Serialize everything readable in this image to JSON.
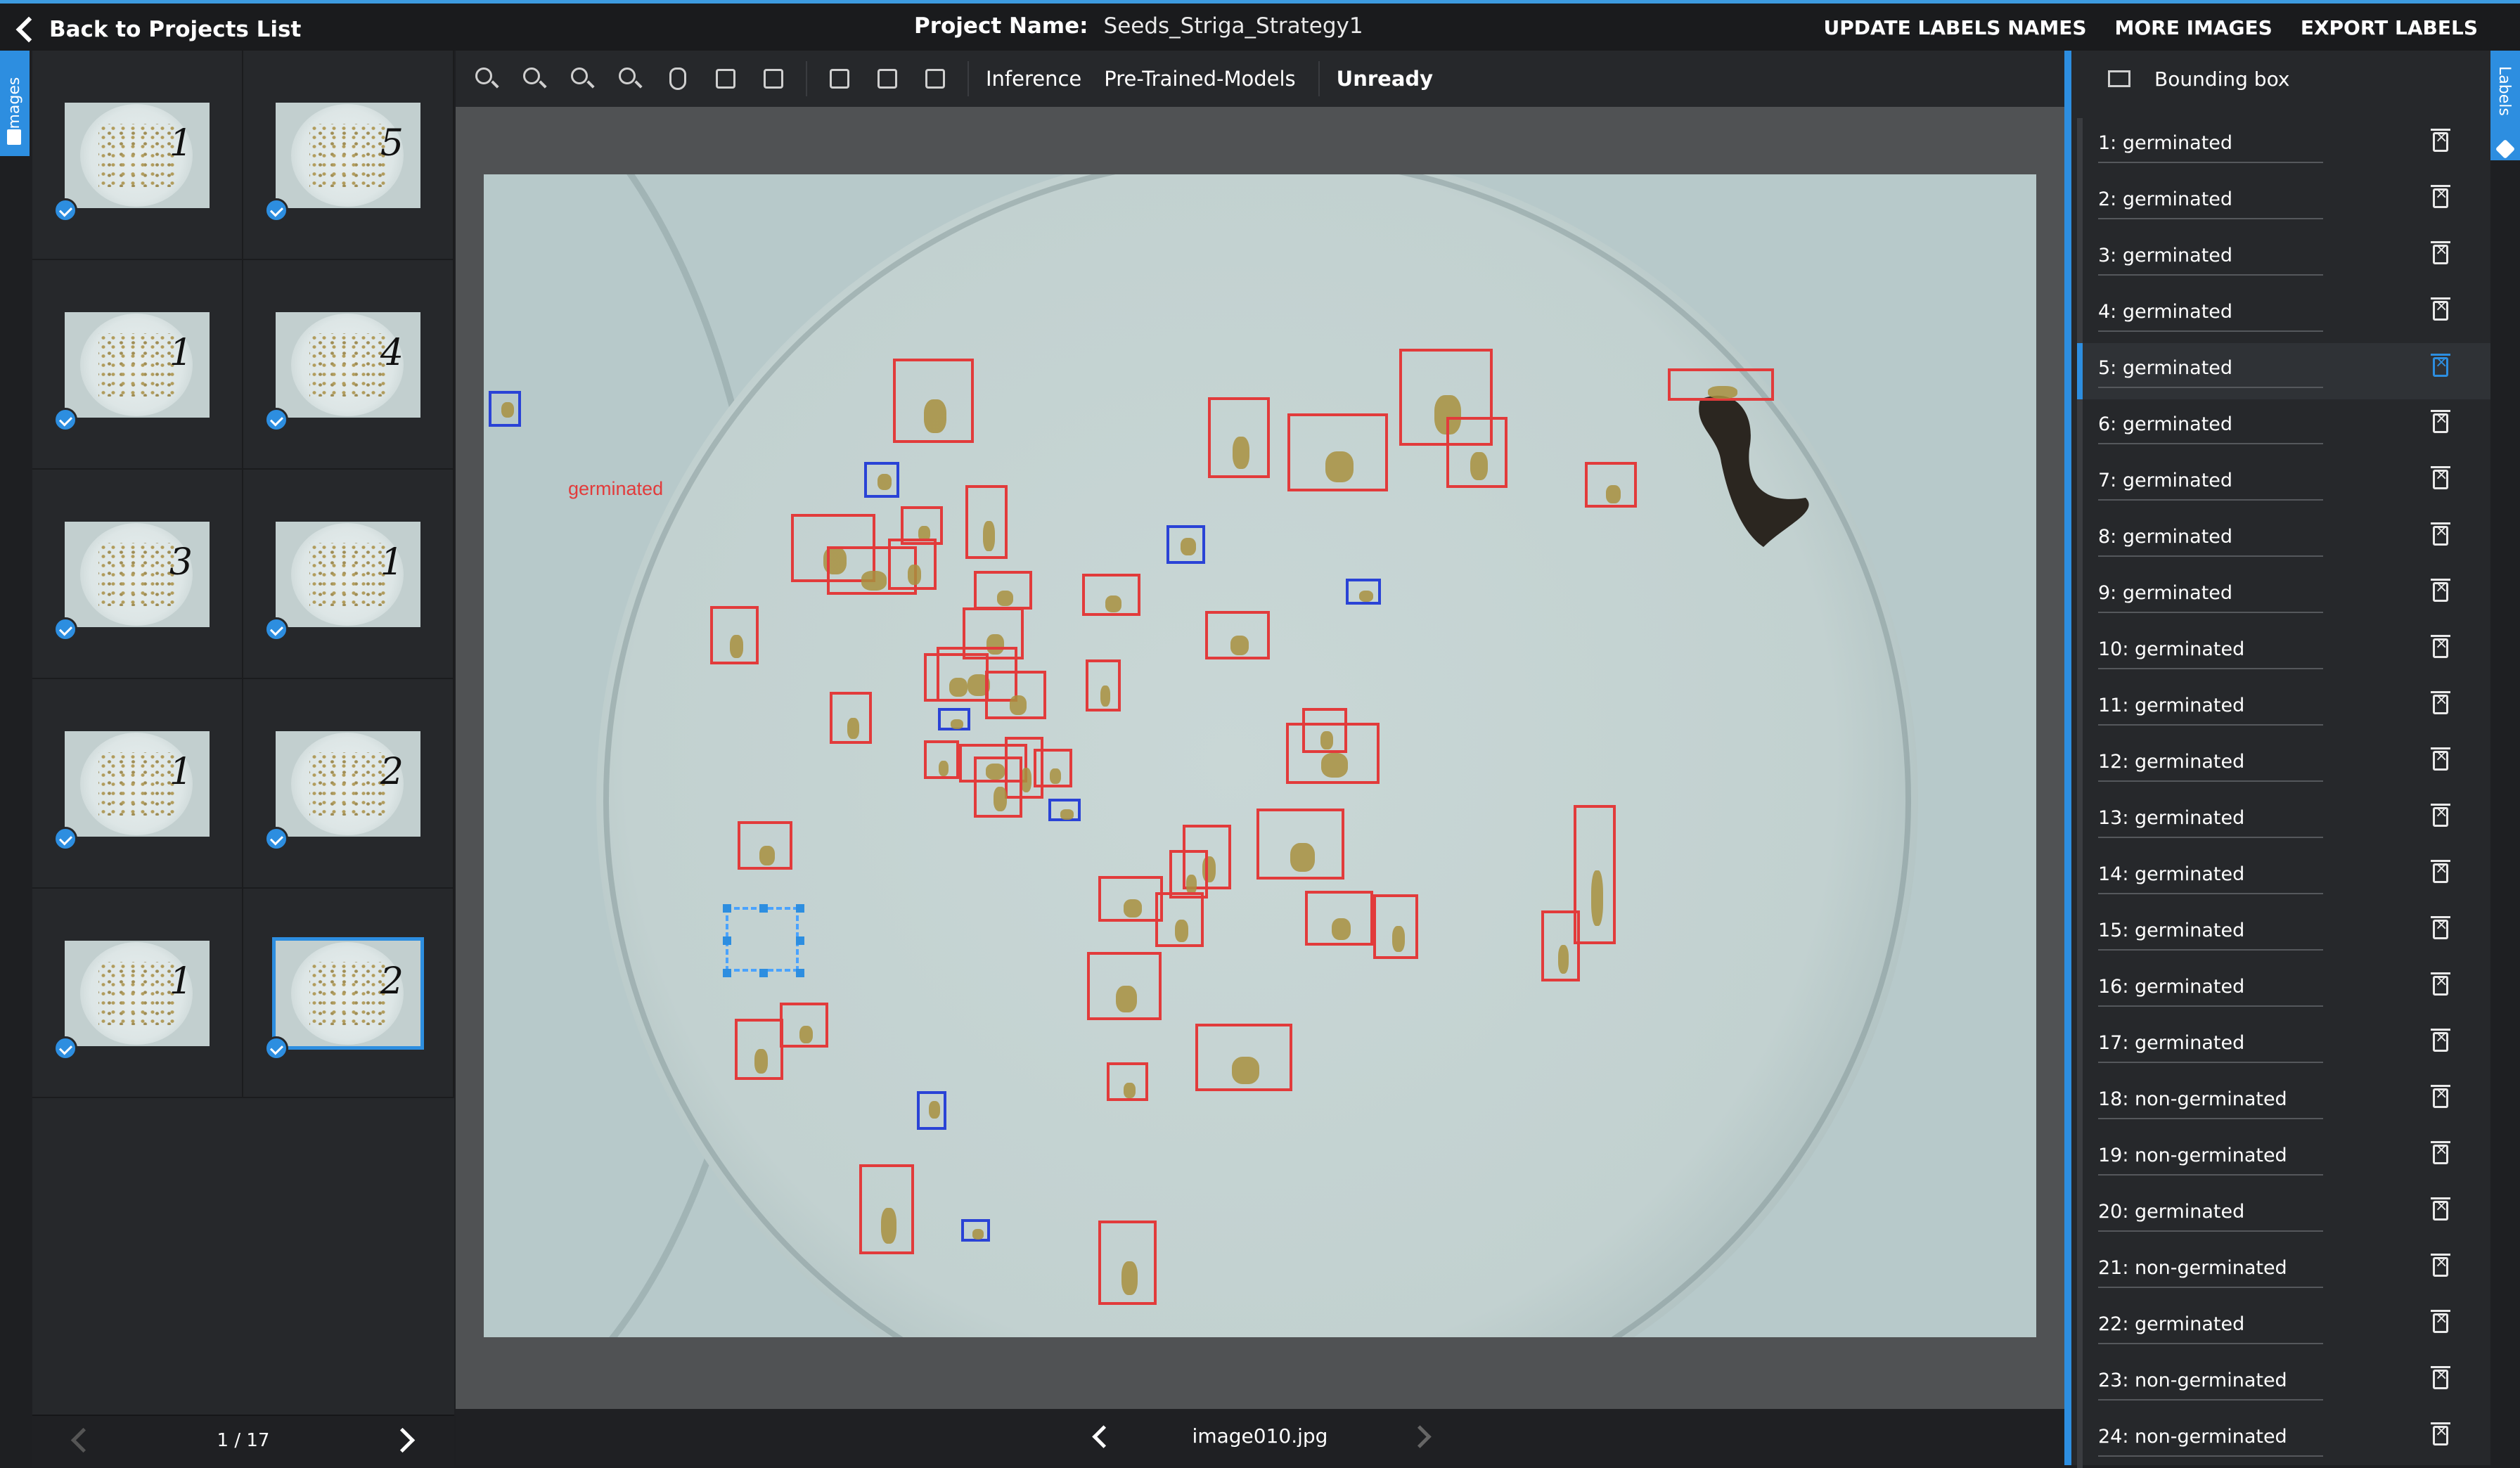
{
  "header": {
    "back_label": "Back to Projects List",
    "project_label": "Project Name:",
    "project_name": "Seeds_Striga_Strategy1",
    "links": [
      "UPDATE LABELS NAMES",
      "MORE IMAGES",
      "EXPORT LABELS"
    ]
  },
  "side_tabs": {
    "images": "Images",
    "labels": "Labels"
  },
  "thumbnails": {
    "marks": [
      "1",
      "5",
      "1",
      "4",
      "3",
      "1",
      "1",
      "2",
      "1",
      "2"
    ]
  },
  "pager": {
    "text": "1 / 17"
  },
  "toolbar": {
    "icons": [
      "zoom-in-icon",
      "zoom-out-icon",
      "zoom-reset-icon",
      "zoom-fit-icon",
      "pan-hand-icon",
      "accept-icon",
      "reject-icon",
      "delete-icon",
      "save-icon",
      "export-icon"
    ],
    "inference": "Inference",
    "pretrained": "Pre-Trained-Models",
    "status": "Unready"
  },
  "canvas": {
    "selected_label": "germinated"
  },
  "footer": {
    "filename": "image010.jpg"
  },
  "labels_panel": {
    "tool": "Bounding box",
    "items": [
      "1: germinated",
      "2: germinated",
      "3: germinated",
      "4: germinated",
      "5: germinated",
      "6: germinated",
      "7: germinated",
      "8: germinated",
      "9: germinated",
      "10: germinated",
      "11: germinated",
      "12: germinated",
      "13: germinated",
      "14: germinated",
      "15: germinated",
      "16: germinated",
      "17: germinated",
      "18: non-germinated",
      "19: non-germinated",
      "20: germinated",
      "21: non-germinated",
      "22: germinated",
      "23: non-germinated",
      "24: non-germinated"
    ],
    "active_index": 4
  },
  "colors": {
    "accent": "#2d8ee0",
    "germinated_box": "#e23b3b",
    "nongerminated_box": "#2a43d6"
  }
}
